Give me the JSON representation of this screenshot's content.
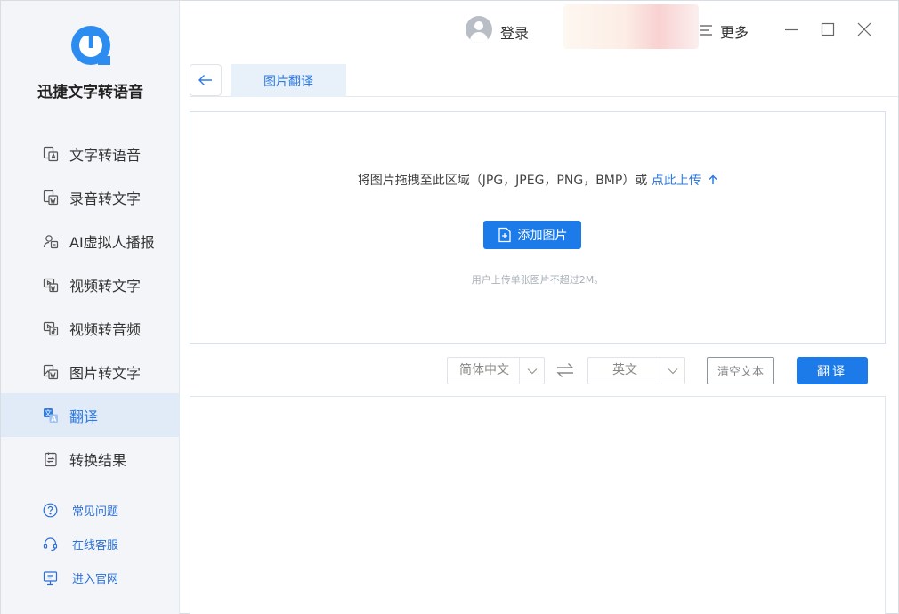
{
  "app": {
    "name": "迅捷文字转语音"
  },
  "sidebar": {
    "items": [
      {
        "label": "文字转语音",
        "icon": "text-to-speech-icon"
      },
      {
        "label": "录音转文字",
        "icon": "audio-to-text-icon"
      },
      {
        "label": "AI虚拟人播报",
        "icon": "ai-avatar-icon"
      },
      {
        "label": "视频转文字",
        "icon": "video-to-text-icon"
      },
      {
        "label": "视频转音频",
        "icon": "video-to-audio-icon"
      },
      {
        "label": "图片转文字",
        "icon": "image-to-text-icon"
      },
      {
        "label": "翻译",
        "icon": "translate-icon",
        "active": true
      },
      {
        "label": "转换结果",
        "icon": "results-icon"
      }
    ],
    "links": [
      {
        "label": "常见问题",
        "icon": "help-icon"
      },
      {
        "label": "在线客服",
        "icon": "headset-icon"
      },
      {
        "label": "进入官网",
        "icon": "monitor-icon"
      }
    ]
  },
  "header": {
    "login_label": "登录",
    "more_label": "更多"
  },
  "tabs": {
    "active_label": "图片翻译"
  },
  "upload": {
    "hint_prefix": "将图片拖拽至此区域（JPG，JPEG，PNG，BMP）或 ",
    "hint_link": "点此上传",
    "add_button": "添加图片",
    "limit_note": "用户上传单张图片不超过2M。"
  },
  "controls": {
    "source_lang": "简体中文",
    "target_lang": "英文",
    "clear_label": "清空文本",
    "translate_label": "翻译"
  },
  "colors": {
    "accent": "#1c7be8",
    "sidebar_bg": "#f3f5f9",
    "active_bg": "#e1ebf7"
  }
}
